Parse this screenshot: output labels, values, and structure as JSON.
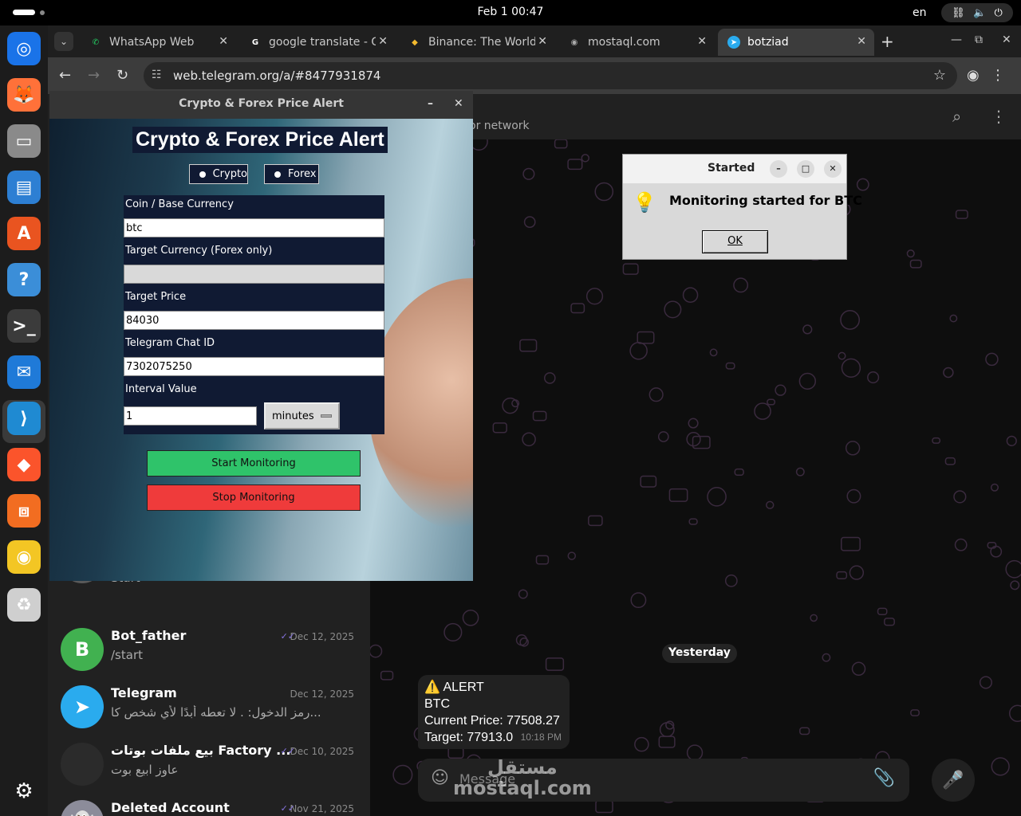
{
  "system": {
    "clock": "Feb 1  00:47",
    "language": "en"
  },
  "dock": {
    "apps": [
      {
        "icon": "chrome-icon",
        "color": "#1a73e8"
      },
      {
        "icon": "firefox-icon",
        "color": "#ff7139"
      },
      {
        "icon": "files-icon",
        "color": "#8a8a8a"
      },
      {
        "icon": "writer-icon",
        "color": "#2d7fd3"
      },
      {
        "icon": "app-center-icon",
        "color": "#e95420"
      },
      {
        "icon": "help-icon",
        "color": "#3b8ed8"
      },
      {
        "icon": "terminal-icon",
        "color": "#3b3b3b"
      },
      {
        "icon": "thunderbird-icon",
        "color": "#1f7ad8"
      },
      {
        "icon": "vscode-icon",
        "color": "#1f8ad2"
      },
      {
        "icon": "brave-icon",
        "color": "#fb542b"
      },
      {
        "icon": "network-app-icon",
        "color": "#f26d21"
      },
      {
        "icon": "rhythmbox-icon",
        "color": "#f3c624"
      },
      {
        "icon": "trash-icon",
        "color": "#cfcfcf"
      }
    ]
  },
  "browser": {
    "tabs": [
      {
        "title": "WhatsApp Web",
        "icon": "whatsapp-icon",
        "color": "#25d366"
      },
      {
        "title": "google translate - G",
        "icon": "google-icon",
        "color": "#ffffff"
      },
      {
        "title": "Binance: The World",
        "icon": "binance-icon",
        "color": "#f3ba2f"
      },
      {
        "title": "mostaql.com",
        "icon": "globe-icon",
        "color": "#aaaaaa"
      },
      {
        "title": "botziad",
        "icon": "telegram-icon",
        "color": "#2aabee"
      }
    ],
    "url": "web.telegram.org/a/#8477931874"
  },
  "telegram": {
    "header_status": "or network",
    "chats": [
      {
        "name": "Bot_father",
        "preview": "/start",
        "date": "Dec 12, 2025",
        "avatar_letter": "B",
        "avatar_color": "#41b150"
      },
      {
        "name": "Telegram",
        "preview": "رمز الدخول: . لا تعطه أبدًا لأي شخص كا...",
        "date": "Dec 12, 2025",
        "avatar_letter": "",
        "avatar_color": "#2aabee"
      },
      {
        "name": "بيع ملفات بوتات Factory ...",
        "preview": "عاوز ابيع بوت",
        "date": "Dec 10, 2025",
        "avatar_letter": "",
        "avatar_color": "#2b2b2b"
      },
      {
        "name": "Deleted Account",
        "preview": "",
        "date": "Nov 21, 2025",
        "avatar_letter": "",
        "avatar_color": "#8c8c9a"
      }
    ],
    "partial_chat_preview": "Start",
    "date_divider": "Yesterday",
    "message": {
      "line1": "⚠️ ALERT",
      "line2": "BTC",
      "line3": "Current Price: 77508.27",
      "line4": "Target: 77913.0",
      "time": "10:18 PM"
    },
    "composer_placeholder": "Message",
    "watermark": "مستقل\nmostaql.com"
  },
  "app": {
    "window_title": "Crypto & Forex Price Alert",
    "heading": "Crypto & Forex Price Alert",
    "radio_crypto": "Crypto",
    "radio_forex": "Forex",
    "coin_label": "Coin / Base Currency",
    "coin_value": "btc",
    "target_currency_label": "Target Currency (Forex only)",
    "target_currency_value": "",
    "target_price_label": "Target Price",
    "target_price_value": "84030",
    "chat_id_label": "Telegram Chat ID",
    "chat_id_value": "7302075250",
    "interval_label": "Interval Value",
    "interval_value": "1",
    "interval_unit": "minutes",
    "start_button": "Start Monitoring",
    "stop_button": "Stop Monitoring"
  },
  "dialog": {
    "title": "Started",
    "message": "Monitoring started for BTC",
    "ok_button": "OK"
  }
}
